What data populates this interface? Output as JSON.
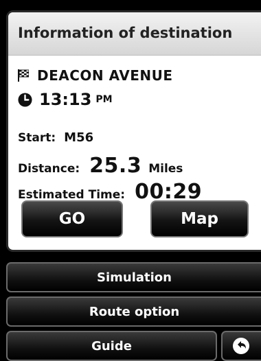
{
  "header": {
    "title": "Information of destination"
  },
  "destination": {
    "name": "DEACON AVENUE",
    "flag_icon": "checkered-flag-icon",
    "arrival_time": "13:13",
    "arrival_ampm": "PM",
    "clock_icon": "clock-icon"
  },
  "info": {
    "start_label": "Start:",
    "start_value": "M56",
    "distance_label": "Distance:",
    "distance_value": "25.3",
    "distance_unit": "Miles",
    "est_time_label": "Estimated Time:",
    "est_time_value": "00:29"
  },
  "buttons": {
    "go": "GO",
    "map": "Map",
    "simulation": "Simulation",
    "route_option": "Route option",
    "guide": "Guide",
    "back_icon": "back-arrow-icon"
  },
  "colors": {
    "panel_bg": "#ffffff",
    "screen_bg": "#000000",
    "button_text": "#ffffff"
  }
}
